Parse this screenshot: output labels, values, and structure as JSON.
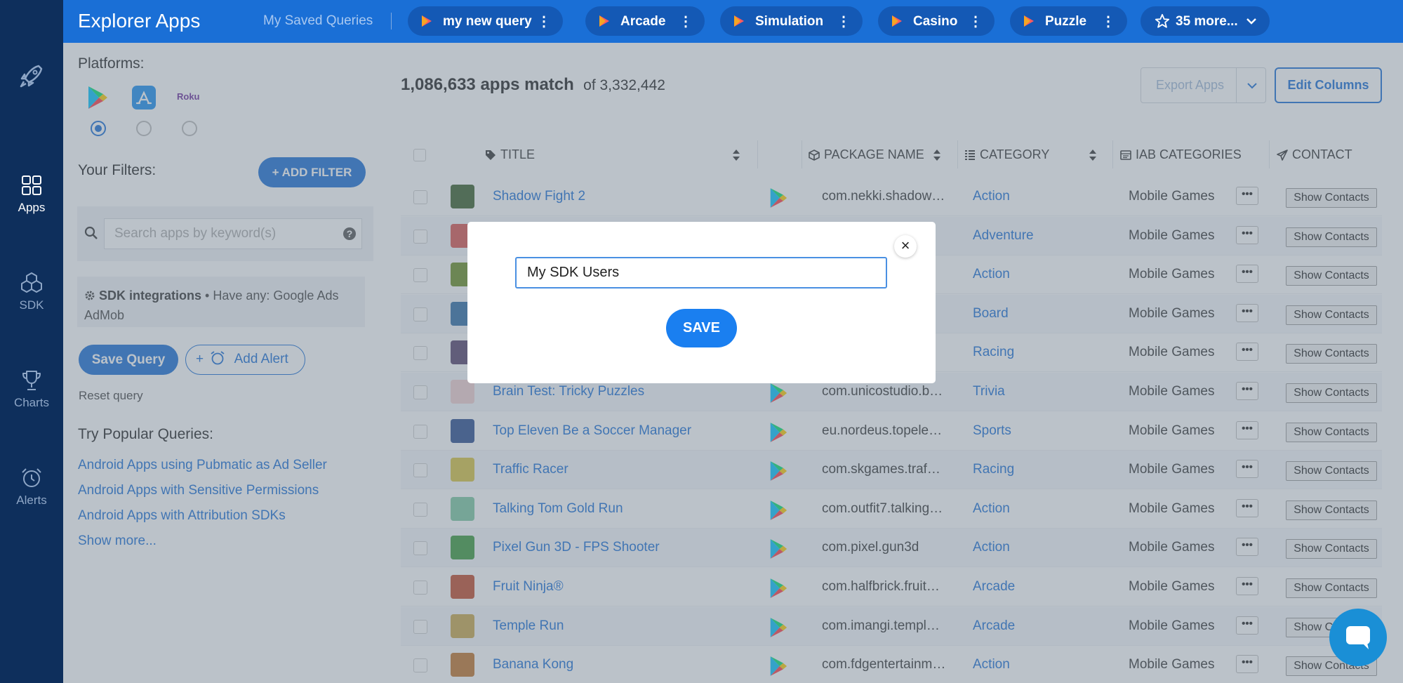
{
  "app": {
    "title": "Explorer Apps"
  },
  "nav": {
    "items": [
      {
        "label": "Apps"
      },
      {
        "label": "SDK"
      },
      {
        "label": "Charts"
      },
      {
        "label": "Alerts"
      }
    ]
  },
  "saved_queries": {
    "label": "My Saved Queries",
    "tabs": [
      {
        "label": "my new query"
      },
      {
        "label": "Arcade"
      },
      {
        "label": "Simulation"
      },
      {
        "label": "Casino"
      },
      {
        "label": "Puzzle"
      }
    ],
    "more_label": "35 more..."
  },
  "sidebar": {
    "platforms_title": "Platforms:",
    "roku_label": "Roku",
    "filters_title": "Your Filters:",
    "add_filter_label": "+ ADD FILTER",
    "search_placeholder": "Search apps by keyword(s)",
    "sdk_filter": {
      "name": "SDK integrations",
      "detail": "• Have any: Google Ads AdMob"
    },
    "save_query_label": "Save Query",
    "add_alert_label": "Add Alert",
    "reset_label": "Reset query",
    "popular_title": "Try Popular Queries:",
    "popular": [
      "Android Apps using Pubmatic as Ad Seller",
      "Android Apps with Sensitive Permissions",
      "Android Apps with Attribution SDKs"
    ],
    "show_more_label": "Show more..."
  },
  "results": {
    "match_count": "1,086,633 apps match",
    "total": "of 3,332,442"
  },
  "toolbar": {
    "export_label": "Export Apps",
    "edit_columns_label": "Edit Columns"
  },
  "table": {
    "columns": {
      "title": "TITLE",
      "package": "PACKAGE NAME",
      "category": "CATEGORY",
      "iab": "IAB CATEGORIES",
      "contact": "CONTACT"
    },
    "more_label": "•••",
    "contacts_label": "Show Contacts",
    "rows": [
      {
        "title": "Shadow Fight 2",
        "package": "com.nekki.shadow…",
        "category": "Action",
        "iab": "Mobile Games, Vi"
      },
      {
        "title": "",
        "package": "",
        "category": "Adventure",
        "iab": "Mobile Games, Vi"
      },
      {
        "title": "",
        "package": "",
        "category": "Action",
        "iab": "Mobile Games, Vi"
      },
      {
        "title": "",
        "package": "",
        "category": "Board",
        "iab": "Mobile Games, Vi"
      },
      {
        "title": "",
        "package": "",
        "category": "Racing",
        "iab": "Mobile Games, Vi"
      },
      {
        "title": "Brain Test: Tricky Puzzles",
        "package": "com.unicostudio.b…",
        "category": "Trivia",
        "iab": "Mobile Games, Vi"
      },
      {
        "title": "Top Eleven Be a Soccer Manager",
        "package": "eu.nordeus.topele…",
        "category": "Sports",
        "iab": "Mobile Games, Vi"
      },
      {
        "title": "Traffic Racer",
        "package": "com.skgames.traf…",
        "category": "Racing",
        "iab": "Mobile Games, Vi"
      },
      {
        "title": "Talking Tom Gold Run",
        "package": "com.outfit7.talking…",
        "category": "Action",
        "iab": "Mobile Games, Vi"
      },
      {
        "title": "Pixel Gun 3D - FPS Shooter",
        "package": "com.pixel.gun3d",
        "category": "Action",
        "iab": "Mobile Games, Vi"
      },
      {
        "title": "Fruit Ninja®",
        "package": "com.halfbrick.fruit…",
        "category": "Arcade",
        "iab": "Mobile Games, Vi"
      },
      {
        "title": "Temple Run",
        "package": "com.imangi.templ…",
        "category": "Arcade",
        "iab": "Mobile Games, Vi"
      },
      {
        "title": "Banana Kong",
        "package": "com.fdgentertainm…",
        "category": "Action",
        "iab": "Mobile Games, Vi"
      }
    ]
  },
  "modal": {
    "input_value": "My SDK Users",
    "save_label": "SAVE",
    "close_label": "×"
  },
  "colors": {
    "primary": "#1a6fd6",
    "sidebar_rail": "#0e2f5c",
    "topbar": "#1a6fd6"
  }
}
